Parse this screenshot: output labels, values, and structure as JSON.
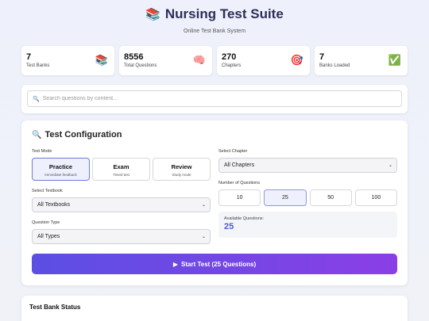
{
  "header": {
    "icon": "books-icon",
    "title": "Nursing Test Suite",
    "subtitle": "Online Test Bank System"
  },
  "stats": [
    {
      "value": "7",
      "label": "Test Banks",
      "icon": "books-icon",
      "glyph": "📚"
    },
    {
      "value": "8556",
      "label": "Total Questions",
      "icon": "brain-icon",
      "glyph": "🧠"
    },
    {
      "value": "270",
      "label": "Chapters",
      "icon": "target-icon",
      "glyph": "🎯"
    },
    {
      "value": "7",
      "label": "Banks Loaded",
      "icon": "check-icon",
      "glyph": "✅"
    }
  ],
  "search": {
    "placeholder": "Search questions by content..."
  },
  "config": {
    "title": "Test Configuration",
    "test_mode_label": "Test Mode",
    "modes": [
      {
        "title": "Practice",
        "sub": "Immediate feedback",
        "active": true
      },
      {
        "title": "Exam",
        "sub": "Timed test",
        "active": false
      },
      {
        "title": "Review",
        "sub": "Study mode",
        "active": false
      }
    ],
    "textbook_label": "Select Textbook",
    "textbook_value": "All Textbooks",
    "qtype_label": "Question Type",
    "qtype_value": "All Types",
    "chapter_label": "Select Chapter",
    "chapter_value": "All Chapters",
    "numq_label": "Number of Questions",
    "num_options": [
      "10",
      "25",
      "50",
      "100"
    ],
    "num_selected": "25",
    "available_label": "Available Questions:",
    "available_value": "25",
    "start_label": "Start Test (25 Questions)",
    "start_icon": "▶"
  },
  "status": {
    "title": "Test Bank Status"
  }
}
